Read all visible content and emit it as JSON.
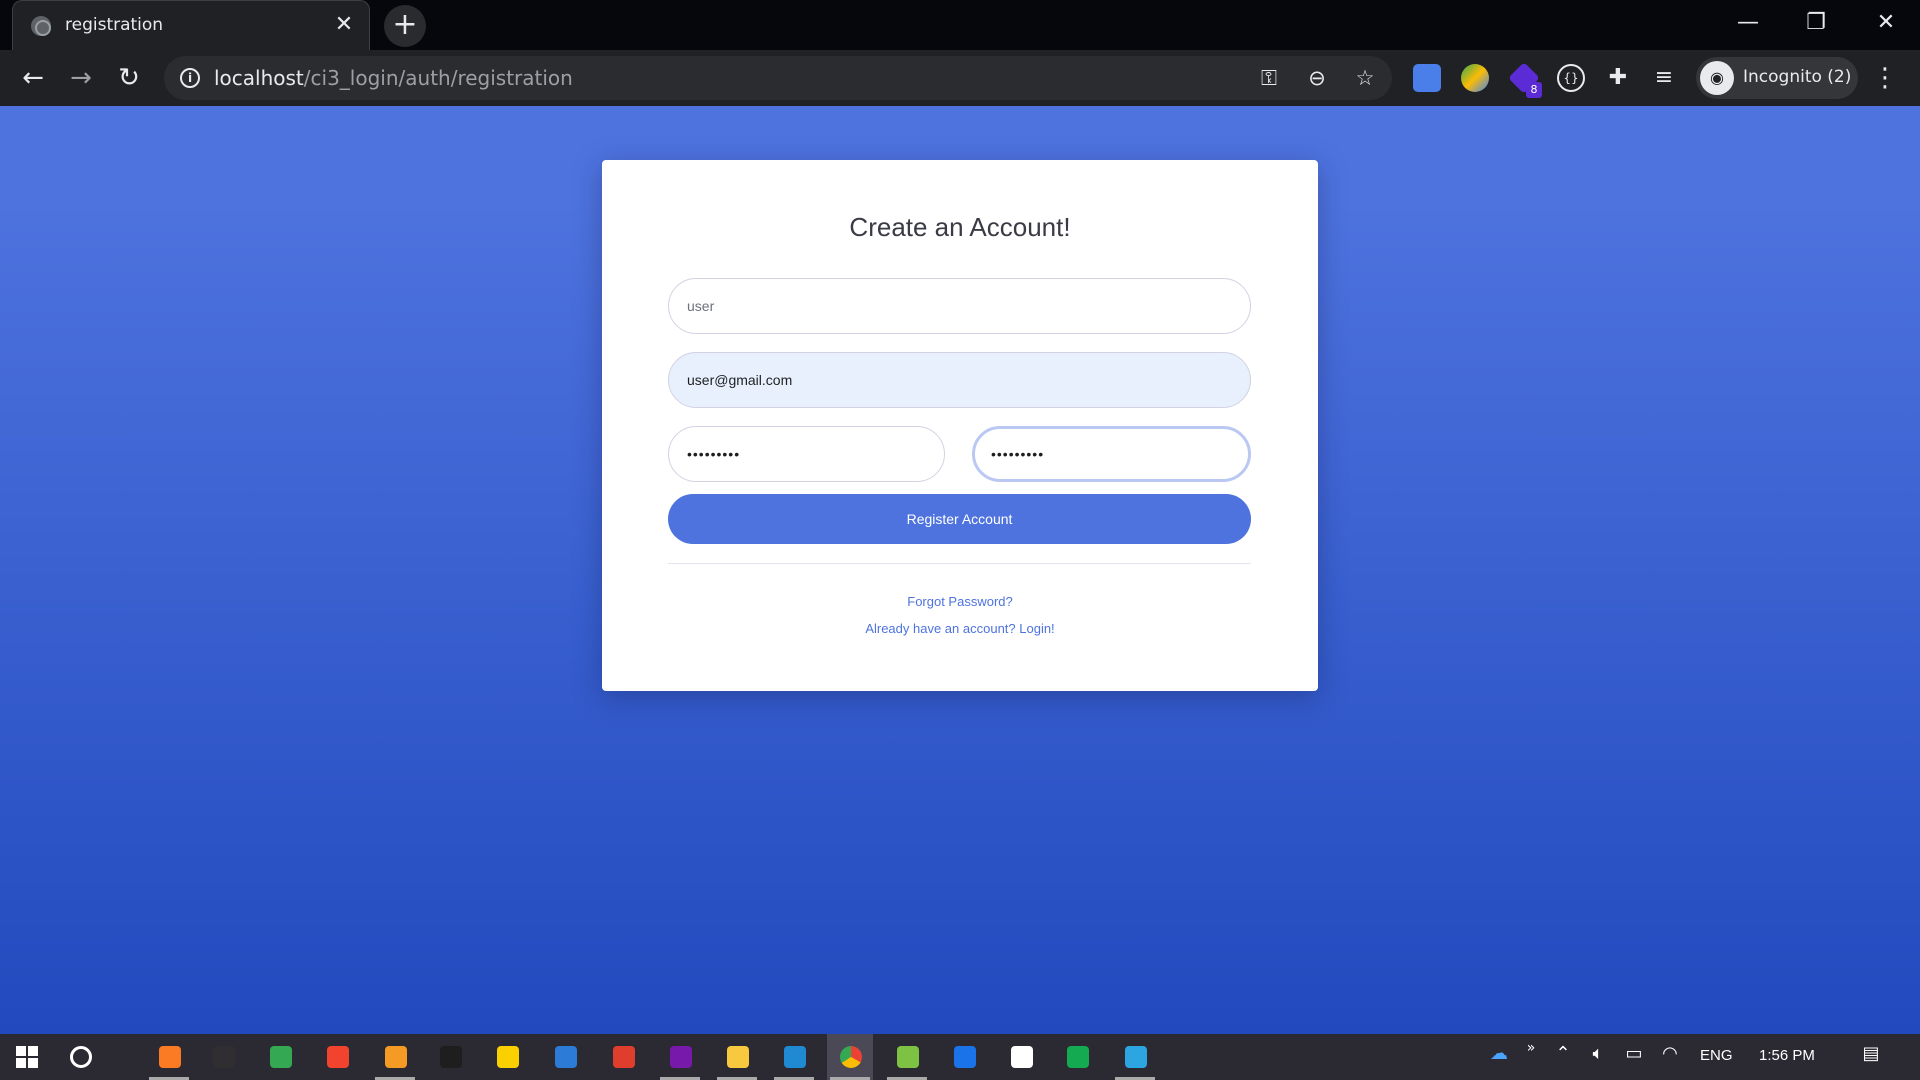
{
  "browser": {
    "tab": {
      "title": "registration",
      "close_glyph": "✕"
    },
    "new_tab_glyph": "+",
    "window_controls": {
      "minimize": "—",
      "restore": "❐",
      "close": "✕"
    },
    "nav": {
      "back": "←",
      "forward": "→",
      "reload": "↻"
    },
    "url": {
      "host": "localhost",
      "path": "/ci3_login/auth/registration"
    },
    "omnibox_icons": [
      "key-icon",
      "zoom-out-icon",
      "star-icon"
    ],
    "extensions": [
      {
        "name": "google-translate-extension-icon",
        "color": "#4a7ee8"
      },
      {
        "name": "colorful-extension-icon",
        "color": "#34a853"
      },
      {
        "name": "purple-extension-icon",
        "color": "#5b2bd6",
        "badge": "8"
      },
      {
        "name": "braces-extension-icon",
        "color": "#e8eaed"
      },
      {
        "name": "puzzle-extensions-icon",
        "color": "#e8eaed"
      },
      {
        "name": "reading-list-icon",
        "color": "#e8eaed"
      }
    ],
    "profile": {
      "label": "Incognito (2)"
    }
  },
  "form": {
    "title": "Create an Account!",
    "name_field": {
      "placeholder": "user"
    },
    "email_field": {
      "value": "user@gmail.com"
    },
    "password_field": {
      "value": "•••••••••"
    },
    "repeat_password_field": {
      "value": "•••••••••"
    },
    "register_button": "Register Account",
    "forgot_password_link": "Forgot Password?",
    "login_link": "Already have an account? Login!"
  },
  "colors": {
    "primary": "#4e73df",
    "primary_dark": "#224abe"
  },
  "taskbar": {
    "apps": [
      {
        "name": "xampp-icon",
        "color": "#fb7a24",
        "underline": true
      },
      {
        "name": "obs-icon",
        "color": "#302e31"
      },
      {
        "name": "colorful-app-icon",
        "color": "#34a853"
      },
      {
        "name": "screen-recorder-icon",
        "color": "#f2432e"
      },
      {
        "name": "sublime-icon",
        "color": "#f59b25",
        "underline": true
      },
      {
        "name": "terminal-icon",
        "color": "#1e1e1e"
      },
      {
        "name": "sticky-notes-icon",
        "color": "#fbd000"
      },
      {
        "name": "photos-icon",
        "color": "#2c7bd6"
      },
      {
        "name": "book-app-icon",
        "color": "#e03e2d"
      },
      {
        "name": "onenote-icon",
        "color": "#7719aa",
        "underline": true
      },
      {
        "name": "file-explorer-icon",
        "color": "#f8c93e",
        "underline": true
      },
      {
        "name": "vscode-icon",
        "color": "#1f8ad2",
        "underline": true
      },
      {
        "name": "chrome-icon",
        "color": "#ea4335",
        "underline": true,
        "active": true
      },
      {
        "name": "calendar-app-icon",
        "color": "#7dc242",
        "underline": true
      },
      {
        "name": "maps-icon",
        "color": "#1a73e8"
      },
      {
        "name": "document-icon",
        "color": "#ffffff"
      },
      {
        "name": "mongodb-icon",
        "color": "#13aa52"
      },
      {
        "name": "telegram-icon",
        "color": "#2ca5e0",
        "underline": true
      }
    ],
    "tray": {
      "language": "ENG",
      "time": "1:56 PM"
    }
  }
}
